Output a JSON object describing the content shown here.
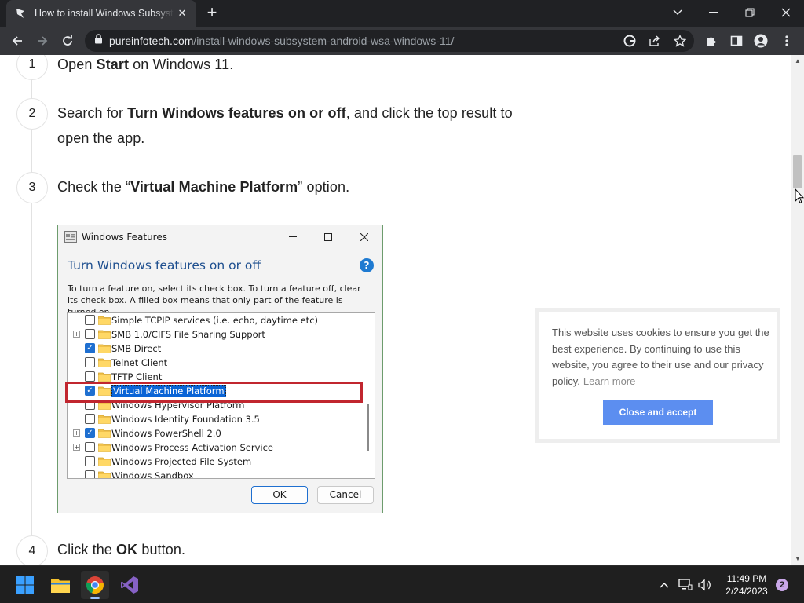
{
  "browser": {
    "tab_title": "How to install Windows Subsystem for Android",
    "tab_close": "✕",
    "new_tab": "+",
    "url_host": "pureinfotech.com",
    "url_path": "/install-windows-subsystem-android-wsa-windows-11/"
  },
  "steps": [
    {
      "num": "1",
      "pre": "Open ",
      "bold": "Start",
      "post": " on Windows 11."
    },
    {
      "num": "2",
      "pre": "Search for ",
      "bold": "Turn Windows features on or off",
      "post": ", and click the top result to",
      "line2": "open the app."
    },
    {
      "num": "3",
      "pre": "Check the “",
      "bold": "Virtual Machine Platform",
      "post": "” option."
    },
    {
      "num": "4",
      "pre": "Click the ",
      "bold": "OK",
      "post": " button."
    }
  ],
  "dialog": {
    "title": "Windows Features",
    "heading": "Turn Windows features on or off",
    "help": "?",
    "description": "To turn a feature on, select its check box. To turn a feature off, clear its check box. A filled box means that only part of the feature is turned on.",
    "features": [
      {
        "label": "Simple TCPIP services (i.e. echo, daytime etc)",
        "checked": false,
        "expandable": false
      },
      {
        "label": "SMB 1.0/CIFS File Sharing Support",
        "checked": false,
        "expandable": true
      },
      {
        "label": "SMB Direct",
        "checked": true,
        "expandable": false
      },
      {
        "label": "Telnet Client",
        "checked": false,
        "expandable": false
      },
      {
        "label": "TFTP Client",
        "checked": false,
        "expandable": false
      },
      {
        "label": "Virtual Machine Platform",
        "checked": true,
        "expandable": false,
        "selected": true
      },
      {
        "label": "Windows Hypervisor Platform",
        "checked": false,
        "expandable": false
      },
      {
        "label": "Windows Identity Foundation 3.5",
        "checked": false,
        "expandable": false
      },
      {
        "label": "Windows PowerShell 2.0",
        "checked": true,
        "expandable": true
      },
      {
        "label": "Windows Process Activation Service",
        "checked": false,
        "expandable": true
      },
      {
        "label": "Windows Projected File System",
        "checked": false,
        "expandable": false
      },
      {
        "label": "Windows Sandbox",
        "checked": false,
        "expandable": false
      }
    ],
    "ok": "OK",
    "cancel": "Cancel"
  },
  "cookie": {
    "text": "This website uses cookies to ensure you get the best experience. By continuing to use this website, you agree to their use and our privacy policy.",
    "learn_more": "Learn more",
    "button": "Close and accept"
  },
  "taskbar": {
    "time": "11:49 PM",
    "date": "2/24/2023",
    "notifications": "2",
    "apps": [
      "start-icon",
      "file-explorer-icon",
      "chrome-icon",
      "visual-studio-icon"
    ]
  },
  "colors": {
    "accent_blue": "#5c8ef0",
    "highlight_red": "#c1262f",
    "chrome_dark": "#202124"
  }
}
